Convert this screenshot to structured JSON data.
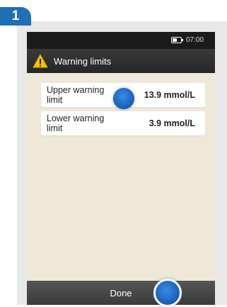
{
  "step": {
    "number": "1"
  },
  "status_bar": {
    "time": "07:00",
    "battery_icon": "battery-icon"
  },
  "header": {
    "title": "Warning limits",
    "icon": "warning-triangle-icon"
  },
  "limits": [
    {
      "label": "Upper warning limit",
      "value": "13.9 mmol/L"
    },
    {
      "label": "Lower warning limit",
      "value": "3.9 mmol/L"
    }
  ],
  "footer": {
    "done_label": "Done"
  },
  "colors": {
    "step_badge": "#1f6fb5",
    "screen_bg": "#efe7d8",
    "warning_yellow": "#f2c200",
    "touch_indicator": "#1e66c2"
  }
}
